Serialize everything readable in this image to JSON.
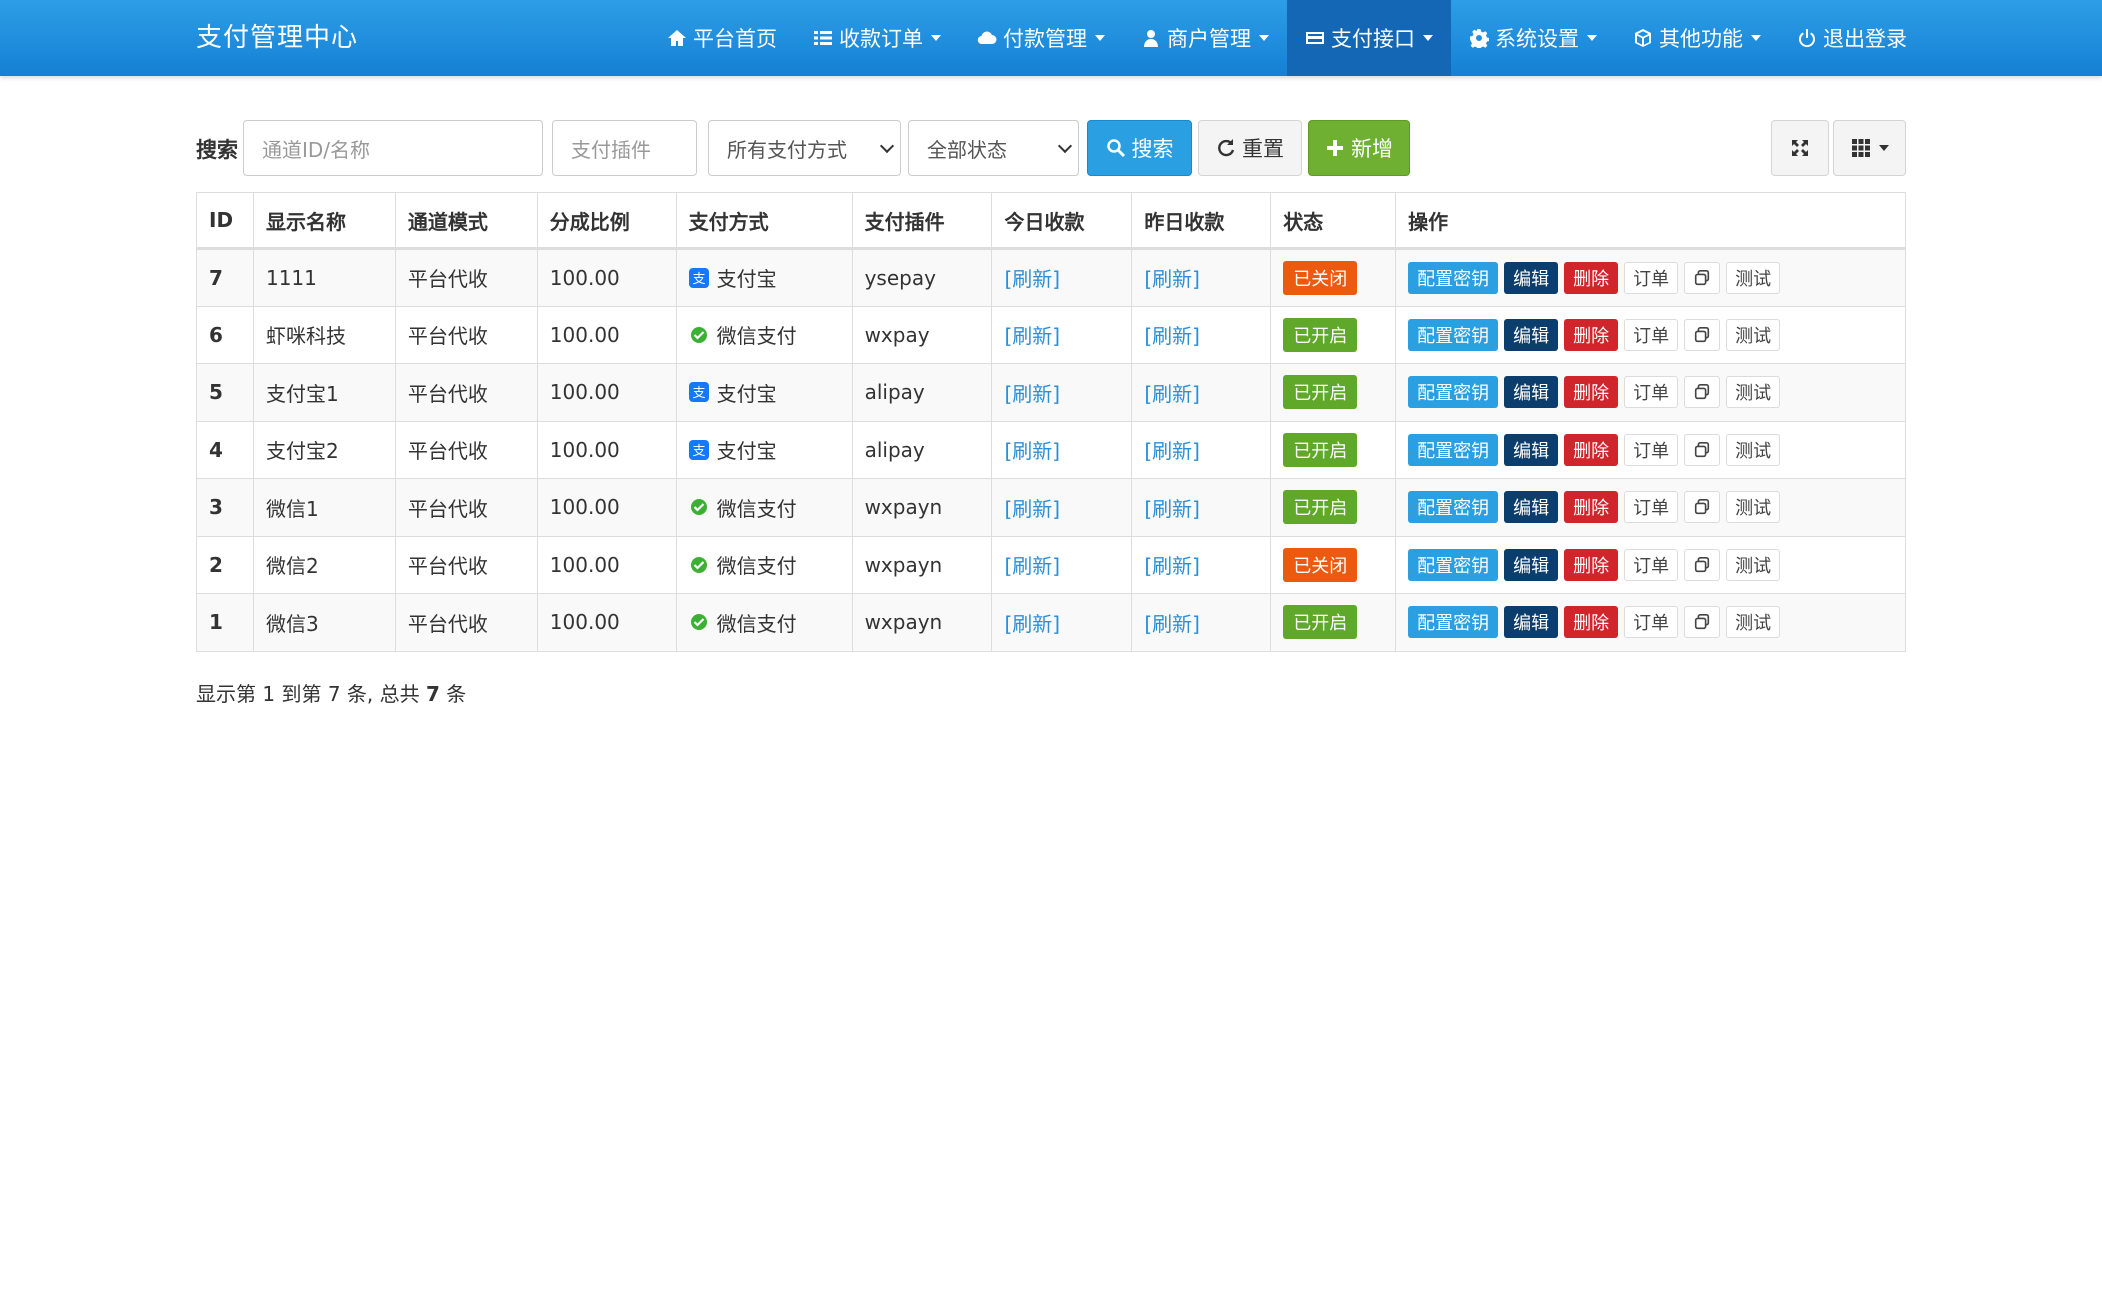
{
  "nav": {
    "brand": "支付管理中心",
    "items": [
      {
        "label": "平台首页",
        "icon": "home-icon"
      },
      {
        "label": "收款订单",
        "icon": "list-icon"
      },
      {
        "label": "付款管理",
        "icon": "cloud-icon"
      },
      {
        "label": "商户管理",
        "icon": "user-icon"
      },
      {
        "label": "支付接口",
        "icon": "credit-card-icon"
      },
      {
        "label": "系统设置",
        "icon": "gear-icon"
      },
      {
        "label": "其他功能",
        "icon": "cube-icon"
      },
      {
        "label": "退出登录",
        "icon": "power-icon"
      }
    ]
  },
  "toolbar": {
    "search_label": "搜索",
    "channel_placeholder": "通道ID/名称",
    "plugin_placeholder": "支付插件",
    "paytype_value": "所有支付方式",
    "status_value": "全部状态",
    "search_btn": "搜索",
    "reset_btn": "重置",
    "add_btn": "新增"
  },
  "table": {
    "headers": [
      "ID",
      "显示名称",
      "通道模式",
      "分成比例",
      "支付方式",
      "支付插件",
      "今日收款",
      "昨日收款",
      "状态",
      "操作"
    ],
    "rows": [
      {
        "id": "7",
        "name": "1111",
        "mode": "平台代收",
        "ratio": "100.00",
        "paytype": "支付宝",
        "plugin": "ysepay",
        "today": "[刷新]",
        "yesterday": "[刷新]",
        "status": "已关闭"
      },
      {
        "id": "6",
        "name": "虾咪科技",
        "mode": "平台代收",
        "ratio": "100.00",
        "paytype": "微信支付",
        "plugin": "wxpay",
        "today": "[刷新]",
        "yesterday": "[刷新]",
        "status": "已开启"
      },
      {
        "id": "5",
        "name": "支付宝1",
        "mode": "平台代收",
        "ratio": "100.00",
        "paytype": "支付宝",
        "plugin": "alipay",
        "today": "[刷新]",
        "yesterday": "[刷新]",
        "status": "已开启"
      },
      {
        "id": "4",
        "name": "支付宝2",
        "mode": "平台代收",
        "ratio": "100.00",
        "paytype": "支付宝",
        "plugin": "alipay",
        "today": "[刷新]",
        "yesterday": "[刷新]",
        "status": "已开启"
      },
      {
        "id": "3",
        "name": "微信1",
        "mode": "平台代收",
        "ratio": "100.00",
        "paytype": "微信支付",
        "plugin": "wxpayn",
        "today": "[刷新]",
        "yesterday": "[刷新]",
        "status": "已开启"
      },
      {
        "id": "2",
        "name": "微信2",
        "mode": "平台代收",
        "ratio": "100.00",
        "paytype": "微信支付",
        "plugin": "wxpayn",
        "today": "[刷新]",
        "yesterday": "[刷新]",
        "status": "已关闭"
      },
      {
        "id": "1",
        "name": "微信3",
        "mode": "平台代收",
        "ratio": "100.00",
        "paytype": "微信支付",
        "plugin": "wxpayn",
        "today": "[刷新]",
        "yesterday": "[刷新]",
        "status": "已开启"
      }
    ],
    "ops": {
      "config": "配置密钥",
      "edit": "编辑",
      "delete": "删除",
      "orders": "订单",
      "test": "测试"
    }
  },
  "pagination": {
    "prefix": "显示第",
    "from": "1",
    "mid1": "到第",
    "to": "7",
    "mid2": "条, 总共",
    "total": "7",
    "suffix": "条"
  },
  "colors": {
    "navbar": "#1e8fdc",
    "primary": "#2a9fe2",
    "success": "#6fb033",
    "danger": "#d0262b",
    "closed": "#ec5a10",
    "open": "#5fa82a",
    "alipay": "#1677ff",
    "wechat": "#3cb034"
  }
}
